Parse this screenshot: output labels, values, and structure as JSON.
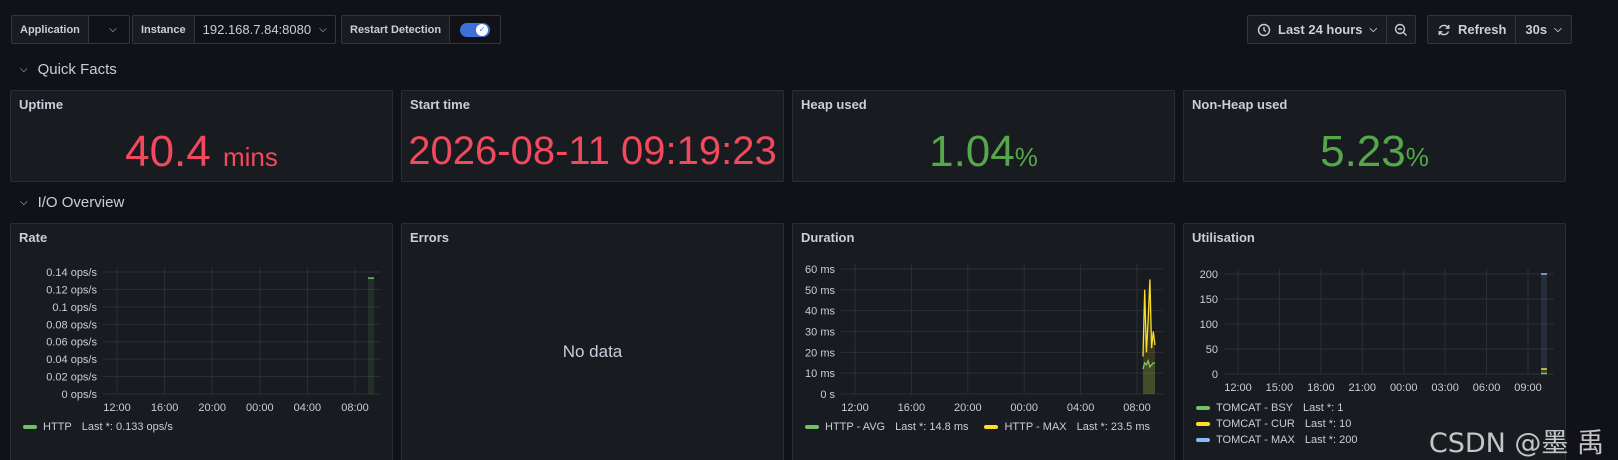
{
  "vars": {
    "application": {
      "label": "Application",
      "value": ""
    },
    "instance": {
      "label": "Instance",
      "value": "192.168.7.84:8080"
    },
    "restart": {
      "label": "Restart Detection"
    }
  },
  "toolbar": {
    "time_range": "Last 24 hours",
    "refresh": "Refresh",
    "interval": "30s"
  },
  "rows": {
    "quick_facts": "Quick Facts",
    "io_overview": "I/O Overview"
  },
  "quick": {
    "uptime": {
      "title": "Uptime",
      "value": "40.4",
      "unit": "mins"
    },
    "start": {
      "title": "Start time",
      "value": "2026-08-11 09:19:23"
    },
    "heap": {
      "title": "Heap used",
      "value": "1.04",
      "unit": "%"
    },
    "nonheap": {
      "title": "Non-Heap used",
      "value": "5.23",
      "unit": "%"
    }
  },
  "errors": {
    "title": "Errors",
    "no_data": "No data"
  },
  "colors": {
    "red": "#f2495c",
    "green": "#73bf69",
    "yellow": "#fade2a",
    "blue": "#8ab8ff"
  },
  "watermark": "CSDN @墨 禹",
  "chart_data": [
    {
      "type": "line",
      "title": "Rate",
      "xticks": [
        "12:00",
        "16:00",
        "20:00",
        "00:00",
        "04:00",
        "08:00"
      ],
      "yticks": [
        "0 ops/s",
        "0.02 ops/s",
        "0.04 ops/s",
        "0.06 ops/s",
        "0.08 ops/s",
        "0.1 ops/s",
        "0.12 ops/s",
        "0.14 ops/s"
      ],
      "ylim": [
        0,
        0.14
      ],
      "series": [
        {
          "name": "HTTP",
          "legend": "Last *: 0.133 ops/s",
          "color": "#73bf69",
          "values": [
            0.133
          ]
        }
      ]
    },
    {
      "type": "line",
      "title": "Duration",
      "xticks": [
        "12:00",
        "16:00",
        "20:00",
        "00:00",
        "04:00",
        "08:00"
      ],
      "yticks": [
        "0 s",
        "10 ms",
        "20 ms",
        "30 ms",
        "40 ms",
        "50 ms",
        "60 ms"
      ],
      "ylim": [
        0,
        60
      ],
      "series": [
        {
          "name": "HTTP - AVG",
          "legend": "Last *: 14.8 ms",
          "color": "#73bf69",
          "values": [
            12,
            15,
            14,
            16,
            13,
            14,
            15,
            14.8
          ]
        },
        {
          "name": "HTTP - MAX",
          "legend": "Last *: 23.5 ms",
          "color": "#fade2a",
          "values": [
            18,
            50,
            20,
            35,
            55,
            22,
            30,
            23.5
          ]
        }
      ]
    },
    {
      "type": "line",
      "title": "Utilisation",
      "xticks": [
        "12:00",
        "15:00",
        "18:00",
        "21:00",
        "00:00",
        "03:00",
        "06:00",
        "09:00"
      ],
      "yticks": [
        "0",
        "50",
        "100",
        "150",
        "200"
      ],
      "ylim": [
        0,
        200
      ],
      "series": [
        {
          "name": "TOMCAT - BSY",
          "legend": "Last *: 1",
          "color": "#73bf69",
          "values": [
            1
          ]
        },
        {
          "name": "TOMCAT - CUR",
          "legend": "Last *: 10",
          "color": "#fade2a",
          "values": [
            10
          ]
        },
        {
          "name": "TOMCAT - MAX",
          "legend": "Last *: 200",
          "color": "#8ab8ff",
          "values": [
            200
          ]
        }
      ]
    }
  ]
}
